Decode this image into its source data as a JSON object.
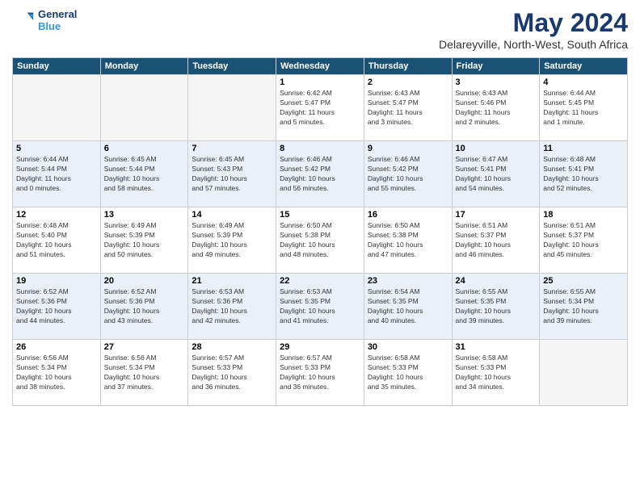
{
  "logo": {
    "line1": "General",
    "line2": "Blue"
  },
  "title": "May 2024",
  "location": "Delareyville, North-West, South Africa",
  "weekdays": [
    "Sunday",
    "Monday",
    "Tuesday",
    "Wednesday",
    "Thursday",
    "Friday",
    "Saturday"
  ],
  "weeks": [
    [
      {
        "day": "",
        "info": ""
      },
      {
        "day": "",
        "info": ""
      },
      {
        "day": "",
        "info": ""
      },
      {
        "day": "1",
        "info": "Sunrise: 6:42 AM\nSunset: 5:47 PM\nDaylight: 11 hours\nand 5 minutes."
      },
      {
        "day": "2",
        "info": "Sunrise: 6:43 AM\nSunset: 5:47 PM\nDaylight: 11 hours\nand 3 minutes."
      },
      {
        "day": "3",
        "info": "Sunrise: 6:43 AM\nSunset: 5:46 PM\nDaylight: 11 hours\nand 2 minutes."
      },
      {
        "day": "4",
        "info": "Sunrise: 6:44 AM\nSunset: 5:45 PM\nDaylight: 11 hours\nand 1 minute."
      }
    ],
    [
      {
        "day": "5",
        "info": "Sunrise: 6:44 AM\nSunset: 5:44 PM\nDaylight: 11 hours\nand 0 minutes."
      },
      {
        "day": "6",
        "info": "Sunrise: 6:45 AM\nSunset: 5:44 PM\nDaylight: 10 hours\nand 58 minutes."
      },
      {
        "day": "7",
        "info": "Sunrise: 6:45 AM\nSunset: 5:43 PM\nDaylight: 10 hours\nand 57 minutes."
      },
      {
        "day": "8",
        "info": "Sunrise: 6:46 AM\nSunset: 5:42 PM\nDaylight: 10 hours\nand 56 minutes."
      },
      {
        "day": "9",
        "info": "Sunrise: 6:46 AM\nSunset: 5:42 PM\nDaylight: 10 hours\nand 55 minutes."
      },
      {
        "day": "10",
        "info": "Sunrise: 6:47 AM\nSunset: 5:41 PM\nDaylight: 10 hours\nand 54 minutes."
      },
      {
        "day": "11",
        "info": "Sunrise: 6:48 AM\nSunset: 5:41 PM\nDaylight: 10 hours\nand 52 minutes."
      }
    ],
    [
      {
        "day": "12",
        "info": "Sunrise: 6:48 AM\nSunset: 5:40 PM\nDaylight: 10 hours\nand 51 minutes."
      },
      {
        "day": "13",
        "info": "Sunrise: 6:49 AM\nSunset: 5:39 PM\nDaylight: 10 hours\nand 50 minutes."
      },
      {
        "day": "14",
        "info": "Sunrise: 6:49 AM\nSunset: 5:39 PM\nDaylight: 10 hours\nand 49 minutes."
      },
      {
        "day": "15",
        "info": "Sunrise: 6:50 AM\nSunset: 5:38 PM\nDaylight: 10 hours\nand 48 minutes."
      },
      {
        "day": "16",
        "info": "Sunrise: 6:50 AM\nSunset: 5:38 PM\nDaylight: 10 hours\nand 47 minutes."
      },
      {
        "day": "17",
        "info": "Sunrise: 6:51 AM\nSunset: 5:37 PM\nDaylight: 10 hours\nand 46 minutes."
      },
      {
        "day": "18",
        "info": "Sunrise: 6:51 AM\nSunset: 5:37 PM\nDaylight: 10 hours\nand 45 minutes."
      }
    ],
    [
      {
        "day": "19",
        "info": "Sunrise: 6:52 AM\nSunset: 5:36 PM\nDaylight: 10 hours\nand 44 minutes."
      },
      {
        "day": "20",
        "info": "Sunrise: 6:52 AM\nSunset: 5:36 PM\nDaylight: 10 hours\nand 43 minutes."
      },
      {
        "day": "21",
        "info": "Sunrise: 6:53 AM\nSunset: 5:36 PM\nDaylight: 10 hours\nand 42 minutes."
      },
      {
        "day": "22",
        "info": "Sunrise: 6:53 AM\nSunset: 5:35 PM\nDaylight: 10 hours\nand 41 minutes."
      },
      {
        "day": "23",
        "info": "Sunrise: 6:54 AM\nSunset: 5:35 PM\nDaylight: 10 hours\nand 40 minutes."
      },
      {
        "day": "24",
        "info": "Sunrise: 6:55 AM\nSunset: 5:35 PM\nDaylight: 10 hours\nand 39 minutes."
      },
      {
        "day": "25",
        "info": "Sunrise: 6:55 AM\nSunset: 5:34 PM\nDaylight: 10 hours\nand 39 minutes."
      }
    ],
    [
      {
        "day": "26",
        "info": "Sunrise: 6:56 AM\nSunset: 5:34 PM\nDaylight: 10 hours\nand 38 minutes."
      },
      {
        "day": "27",
        "info": "Sunrise: 6:56 AM\nSunset: 5:34 PM\nDaylight: 10 hours\nand 37 minutes."
      },
      {
        "day": "28",
        "info": "Sunrise: 6:57 AM\nSunset: 5:33 PM\nDaylight: 10 hours\nand 36 minutes."
      },
      {
        "day": "29",
        "info": "Sunrise: 6:57 AM\nSunset: 5:33 PM\nDaylight: 10 hours\nand 36 minutes."
      },
      {
        "day": "30",
        "info": "Sunrise: 6:58 AM\nSunset: 5:33 PM\nDaylight: 10 hours\nand 35 minutes."
      },
      {
        "day": "31",
        "info": "Sunrise: 6:58 AM\nSunset: 5:33 PM\nDaylight: 10 hours\nand 34 minutes."
      },
      {
        "day": "",
        "info": ""
      }
    ]
  ]
}
